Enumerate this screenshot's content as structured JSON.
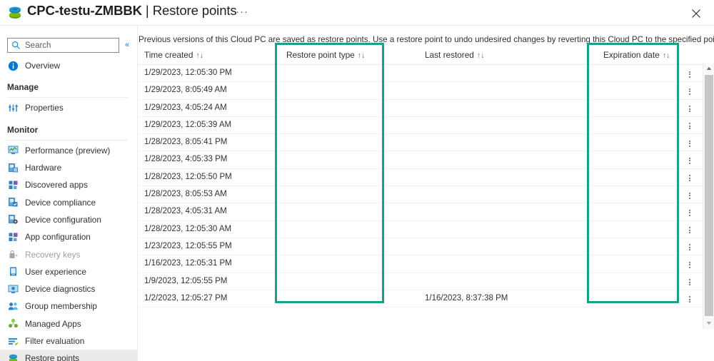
{
  "window": {
    "title_main": "CPC-testu-ZMBBK",
    "title_separator": "|",
    "title_sub": "Restore points",
    "more_label": "···",
    "close_label": "✕",
    "app_icon": "cloud-pc-icon"
  },
  "sidebar": {
    "search": {
      "placeholder": "Search",
      "value": "",
      "icon": "search-icon"
    },
    "collapse_label": "«",
    "items": [
      {
        "label": "Overview",
        "icon": "info-icon",
        "type": "item",
        "state": "normal"
      },
      {
        "label": "Manage",
        "icon": "",
        "type": "group"
      },
      {
        "label": "Properties",
        "icon": "properties-icon",
        "type": "item",
        "state": "normal"
      },
      {
        "label": "Monitor",
        "icon": "",
        "type": "group"
      },
      {
        "label": "Performance (preview)",
        "icon": "performance-icon",
        "type": "item",
        "state": "normal"
      },
      {
        "label": "Hardware",
        "icon": "hardware-icon",
        "type": "item",
        "state": "normal"
      },
      {
        "label": "Discovered apps",
        "icon": "discovered-apps-icon",
        "type": "item",
        "state": "normal"
      },
      {
        "label": "Device compliance",
        "icon": "device-compliance-icon",
        "type": "item",
        "state": "normal"
      },
      {
        "label": "Device configuration",
        "icon": "device-config-icon",
        "type": "item",
        "state": "normal"
      },
      {
        "label": "App configuration",
        "icon": "app-config-icon",
        "type": "item",
        "state": "normal"
      },
      {
        "label": "Recovery keys",
        "icon": "recovery-keys-icon",
        "type": "item",
        "state": "disabled"
      },
      {
        "label": "User experience",
        "icon": "user-experience-icon",
        "type": "item",
        "state": "normal"
      },
      {
        "label": "Device diagnostics",
        "icon": "device-diagnostics-icon",
        "type": "item",
        "state": "normal"
      },
      {
        "label": "Group membership",
        "icon": "group-membership-icon",
        "type": "item",
        "state": "normal"
      },
      {
        "label": "Managed Apps",
        "icon": "managed-apps-icon",
        "type": "item",
        "state": "normal"
      },
      {
        "label": "Filter evaluation",
        "icon": "filter-evaluation-icon",
        "type": "item",
        "state": "normal"
      },
      {
        "label": "Restore points",
        "icon": "restore-points-icon",
        "type": "item",
        "state": "selected"
      }
    ]
  },
  "main": {
    "description": "Previous versions of this Cloud PC are saved as restore points. Use a restore point to undo undesired changes by reverting this Cloud PC to the specified point in time.",
    "table": {
      "columns": [
        {
          "label": "Time created",
          "sort": "↑↓",
          "key": "time_created"
        },
        {
          "label": "Restore point type",
          "sort": "↑↓",
          "key": "restore_point_type"
        },
        {
          "label": "Last restored",
          "sort": "↑↓",
          "key": "last_restored"
        },
        {
          "label": "Expiration date",
          "sort": "↑↓",
          "key": "expiration_date"
        }
      ],
      "rows": [
        {
          "time_created": "1/29/2023, 12:05:30 PM",
          "restore_point_type": "",
          "last_restored": "",
          "expiration_date": ""
        },
        {
          "time_created": "1/29/2023, 8:05:49 AM",
          "restore_point_type": "",
          "last_restored": "",
          "expiration_date": ""
        },
        {
          "time_created": "1/29/2023, 4:05:24 AM",
          "restore_point_type": "",
          "last_restored": "",
          "expiration_date": ""
        },
        {
          "time_created": "1/29/2023, 12:05:39 AM",
          "restore_point_type": "",
          "last_restored": "",
          "expiration_date": ""
        },
        {
          "time_created": "1/28/2023, 8:05:41 PM",
          "restore_point_type": "",
          "last_restored": "",
          "expiration_date": ""
        },
        {
          "time_created": "1/28/2023, 4:05:33 PM",
          "restore_point_type": "",
          "last_restored": "",
          "expiration_date": ""
        },
        {
          "time_created": "1/28/2023, 12:05:50 PM",
          "restore_point_type": "",
          "last_restored": "",
          "expiration_date": ""
        },
        {
          "time_created": "1/28/2023, 8:05:53 AM",
          "restore_point_type": "",
          "last_restored": "",
          "expiration_date": ""
        },
        {
          "time_created": "1/28/2023, 4:05:31 AM",
          "restore_point_type": "",
          "last_restored": "",
          "expiration_date": ""
        },
        {
          "time_created": "1/28/2023, 12:05:30 AM",
          "restore_point_type": "",
          "last_restored": "",
          "expiration_date": ""
        },
        {
          "time_created": "1/23/2023, 12:05:55 PM",
          "restore_point_type": "",
          "last_restored": "",
          "expiration_date": ""
        },
        {
          "time_created": "1/16/2023, 12:05:31 PM",
          "restore_point_type": "",
          "last_restored": "",
          "expiration_date": ""
        },
        {
          "time_created": "1/9/2023, 12:05:55 PM",
          "restore_point_type": "",
          "last_restored": "",
          "expiration_date": ""
        },
        {
          "time_created": "1/2/2023, 12:05:27 PM",
          "restore_point_type": "",
          "last_restored": "1/16/2023, 8:37:38 PM",
          "expiration_date": ""
        }
      ]
    },
    "row_menu_label": "row-actions"
  },
  "annotations": {
    "highlight_color": "#17a08a",
    "boxes": [
      {
        "name": "restore-point-type-highlight"
      },
      {
        "name": "expiration-date-highlight"
      }
    ]
  },
  "scrollbar": {
    "up_label": "▲",
    "down_label": "▼"
  },
  "colors": {
    "accent": "#0078d4",
    "highlight": "#17a08a",
    "selected_nav_bg": "#edebe9"
  }
}
